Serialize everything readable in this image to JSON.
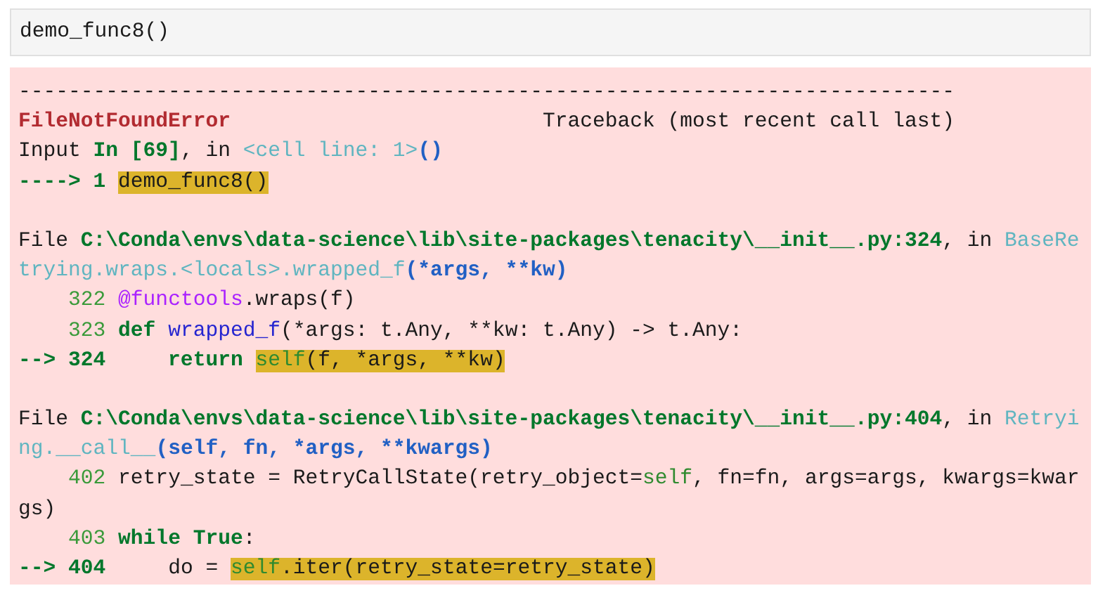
{
  "input_cell": {
    "code": "demo_func8()"
  },
  "output": {
    "lines": [
      {
        "kind": "code",
        "segments": [
          {
            "t": "---------------------------------------------------------------------------",
            "kind": "text",
            "highlighted": false
          }
        ]
      },
      {
        "kind": "code",
        "segments": [
          {
            "t": "FileNotFoundError",
            "kind": "exception",
            "highlighted": false
          },
          {
            "t": "                         Traceback (most recent call last)",
            "kind": "text",
            "highlighted": false
          }
        ]
      },
      {
        "kind": "code",
        "segments": [
          {
            "t": "Input ",
            "kind": "text",
            "highlighted": false
          },
          {
            "t": "In [69]",
            "kind": "keyword",
            "highlighted": false
          },
          {
            "t": ", in ",
            "kind": "text",
            "highlighted": false
          },
          {
            "t": "<cell line: 1>",
            "kind": "location",
            "highlighted": false
          },
          {
            "t": "()",
            "kind": "signature",
            "highlighted": false
          }
        ]
      },
      {
        "kind": "code",
        "segments": [
          {
            "t": "----> 1 ",
            "kind": "keyword",
            "highlighted": false
          },
          {
            "t": "demo_func8()",
            "kind": "text",
            "highlighted": true
          }
        ]
      },
      {
        "kind": "blank"
      },
      {
        "kind": "code",
        "segments": [
          {
            "t": "File ",
            "kind": "text",
            "highlighted": false
          },
          {
            "t": "C:\\Conda\\envs\\data-science\\lib\\site-packages\\tenacity\\__init__.py:324",
            "kind": "keyword",
            "highlighted": false
          },
          {
            "t": ", in ",
            "kind": "text",
            "highlighted": false
          },
          {
            "t": "BaseRe",
            "kind": "location",
            "highlighted": false
          }
        ]
      },
      {
        "kind": "code",
        "segments": [
          {
            "t": "trying.wraps.<locals>.wrapped_f",
            "kind": "location",
            "highlighted": false
          },
          {
            "t": "(*args, **kw)",
            "kind": "signature",
            "highlighted": false
          }
        ]
      },
      {
        "kind": "code",
        "segments": [
          {
            "t": "    322 ",
            "kind": "lineno",
            "highlighted": false
          },
          {
            "t": "@functools",
            "kind": "decorator",
            "highlighted": false
          },
          {
            "t": ".wraps(f)",
            "kind": "text",
            "highlighted": false
          }
        ]
      },
      {
        "kind": "code",
        "segments": [
          {
            "t": "    323 ",
            "kind": "lineno",
            "highlighted": false
          },
          {
            "t": "def",
            "kind": "keyword",
            "highlighted": false
          },
          {
            "t": " wrapped_f",
            "kind": "function",
            "highlighted": false
          },
          {
            "t": "(*args: t.Any, **kw: t.Any) -> t.Any:",
            "kind": "text",
            "highlighted": false
          }
        ]
      },
      {
        "kind": "code",
        "segments": [
          {
            "t": "--> 324     return ",
            "kind": "keyword",
            "highlighted": false
          },
          {
            "t": "self",
            "kind": "builtin",
            "highlighted": true
          },
          {
            "t": "(f, *args, **kw)",
            "kind": "text",
            "highlighted": true
          }
        ]
      },
      {
        "kind": "blank"
      },
      {
        "kind": "code",
        "segments": [
          {
            "t": "File ",
            "kind": "text",
            "highlighted": false
          },
          {
            "t": "C:\\Conda\\envs\\data-science\\lib\\site-packages\\tenacity\\__init__.py:404",
            "kind": "keyword",
            "highlighted": false
          },
          {
            "t": ", in ",
            "kind": "text",
            "highlighted": false
          },
          {
            "t": "Retryi",
            "kind": "location",
            "highlighted": false
          }
        ]
      },
      {
        "kind": "code",
        "segments": [
          {
            "t": "ng.__call__",
            "kind": "location",
            "highlighted": false
          },
          {
            "t": "(self, fn, *args, **kwargs)",
            "kind": "signature",
            "highlighted": false
          }
        ]
      },
      {
        "kind": "code",
        "segments": [
          {
            "t": "    402 ",
            "kind": "lineno",
            "highlighted": false
          },
          {
            "t": "retry_state = RetryCallState(retry_object=",
            "kind": "text",
            "highlighted": false
          },
          {
            "t": "self",
            "kind": "builtin",
            "highlighted": false
          },
          {
            "t": ", fn=fn, args=args, kwargs=kwar",
            "kind": "text",
            "highlighted": false
          }
        ]
      },
      {
        "kind": "code",
        "segments": [
          {
            "t": "gs)",
            "kind": "text",
            "highlighted": false
          }
        ]
      },
      {
        "kind": "code",
        "segments": [
          {
            "t": "    403 ",
            "kind": "lineno",
            "highlighted": false
          },
          {
            "t": "while True",
            "kind": "keyword",
            "highlighted": false
          },
          {
            "t": ":",
            "kind": "text",
            "highlighted": false
          }
        ]
      },
      {
        "kind": "code",
        "segments": [
          {
            "t": "--> 404",
            "kind": "keyword",
            "highlighted": false
          },
          {
            "t": "     do = ",
            "kind": "text",
            "highlighted": false
          },
          {
            "t": "self",
            "kind": "builtin",
            "highlighted": true
          },
          {
            "t": ".iter(retry_state=retry_state)",
            "kind": "text",
            "highlighted": true
          }
        ]
      }
    ]
  }
}
